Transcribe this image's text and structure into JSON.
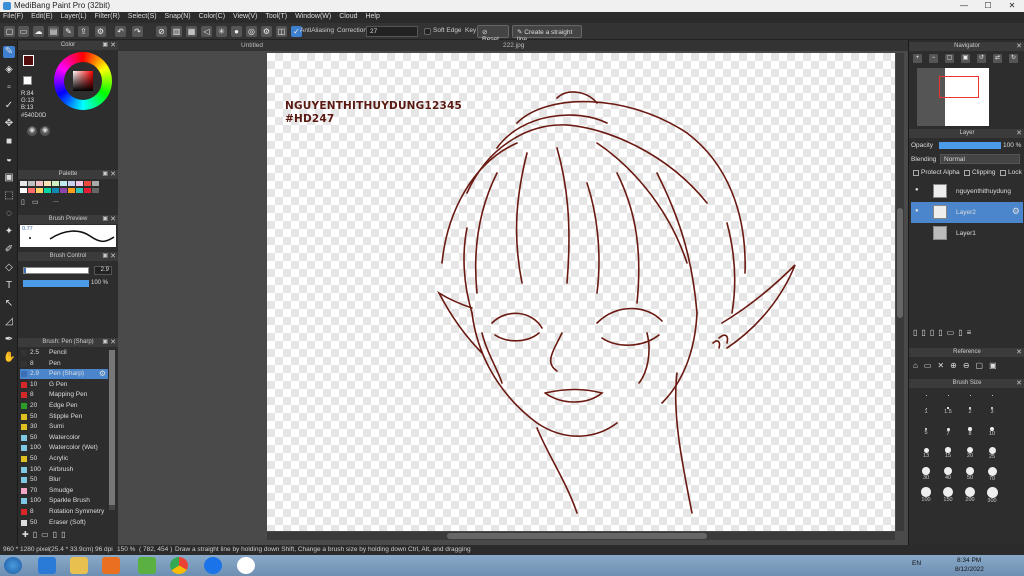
{
  "window": {
    "title": "MediBang Paint Pro (32bit)",
    "minimize": "—",
    "maximize": "☐",
    "close": "✕"
  },
  "menu": [
    "File(F)",
    "Edit(E)",
    "Layer(L)",
    "Filter(R)",
    "Select(S)",
    "Snap(N)",
    "Color(C)",
    "View(V)",
    "Tool(T)",
    "Window(W)",
    "Cloud",
    "Help"
  ],
  "toolbar": {
    "antialiasing": "AntiAliasing",
    "correction_label": "Correction",
    "correction_value": "27",
    "soft_edge": "Soft Edge",
    "key": "Key",
    "reset": "Reset",
    "straight_line": "Create a straight line"
  },
  "panels": {
    "color": {
      "title": "Color",
      "r": "R:84",
      "g": "G:13",
      "b": "B:13",
      "hex": "#540D0D",
      "primary": "#540d0d",
      "secondary": "#ffffff"
    },
    "palette": {
      "title": "Palette",
      "colors": [
        [
          "#e8e8e8",
          "#c0c0c0",
          "#f4c2c2",
          "#f9e4b7",
          "#d0f0c0",
          "#c0e8f0",
          "#c8d0f0",
          "#f0c8e8",
          "#e74c3c",
          "#aaaaaa"
        ],
        [
          "#ffffff",
          "#ff6b6b",
          "#ffd166",
          "#06d6a0",
          "#118ab2",
          "#8e44ad",
          "#ff9f1c",
          "#2ec4b6",
          "#e71d36",
          "#666666"
        ]
      ],
      "more": "..."
    },
    "brush_preview": {
      "title": "Brush Preview",
      "size": "0.77"
    },
    "brush_control": {
      "title": "Brush Control",
      "size": "2.9",
      "opacity": "100 %"
    },
    "brush_list": {
      "title": "Brush: Pen (Sharp)",
      "items": [
        {
          "size": "2.5",
          "name": "Pencil",
          "color": "#333333"
        },
        {
          "size": "8",
          "name": "Pen",
          "color": "#333333"
        },
        {
          "size": "2.9",
          "name": "Pen (Sharp)",
          "color": "#3a6fb5",
          "selected": true
        },
        {
          "size": "10",
          "name": "G Pen",
          "color": "#d62828"
        },
        {
          "size": "8",
          "name": "Mapping Pen",
          "color": "#d62828"
        },
        {
          "size": "20",
          "name": "Edge Pen",
          "color": "#2a9d2a"
        },
        {
          "size": "50",
          "name": "Stipple Pen",
          "color": "#e0c020"
        },
        {
          "size": "30",
          "name": "Sumi",
          "color": "#e0c020"
        },
        {
          "size": "50",
          "name": "Watercolor",
          "color": "#7ec8e3"
        },
        {
          "size": "100",
          "name": "Watercolor (Wet)",
          "color": "#7ec8e3"
        },
        {
          "size": "50",
          "name": "Acrylic",
          "color": "#e0c020"
        },
        {
          "size": "100",
          "name": "Airbrush",
          "color": "#7ec8e3"
        },
        {
          "size": "50",
          "name": "Blur",
          "color": "#7ec8e3"
        },
        {
          "size": "70",
          "name": "Smudge",
          "color": "#f4a6c8"
        },
        {
          "size": "100",
          "name": "Sparkle Brush",
          "color": "#7ec8e3"
        },
        {
          "size": "8",
          "name": "Rotation Symmetry",
          "color": "#d62828"
        },
        {
          "size": "50",
          "name": "Eraser (Soft)",
          "color": "#dddddd"
        }
      ]
    },
    "navigator": {
      "title": "Navigator"
    },
    "layer": {
      "title": "Layer",
      "opacity_label": "Opacity",
      "opacity_value": "100 %",
      "blending_label": "Blending",
      "blending_value": "Normal",
      "protect_alpha": "Protect Alpha",
      "clipping": "Clipping",
      "lock": "Lock",
      "layers": [
        {
          "name": "nguyenthithuydung"
        },
        {
          "name": "Layer2",
          "selected": true
        },
        {
          "name": "Layer1"
        }
      ]
    },
    "reference": {
      "title": "Reference"
    },
    "brush_size": {
      "title": "Brush Size",
      "sizes": [
        "1",
        "1.5",
        "2",
        "3",
        "5",
        "7",
        "8",
        "10",
        "13",
        "15",
        "20",
        "25",
        "30",
        "40",
        "50",
        "70",
        "100",
        "150",
        "200",
        "300"
      ]
    }
  },
  "canvas": {
    "tabs": [
      "Untitled",
      "222.jpg"
    ],
    "signature_line1": "NGUYENTHITHUYDUNG12345",
    "signature_line2": "#HD247",
    "line_color": "#6b1a12"
  },
  "status": {
    "size": "960 * 1280 pixel",
    "cm": "(25.4 * 33.9cm)",
    "dpi": "96 dpi",
    "zoom": "150 %",
    "coords": "( 782, 454 )",
    "hint": "Draw a straight line by holding down Shift, Change a brush size by holding down Ctrl, Alt, and dragging"
  },
  "taskbar": {
    "lang": "EN",
    "time": "8:34 PM",
    "date": "8/12/2022"
  }
}
